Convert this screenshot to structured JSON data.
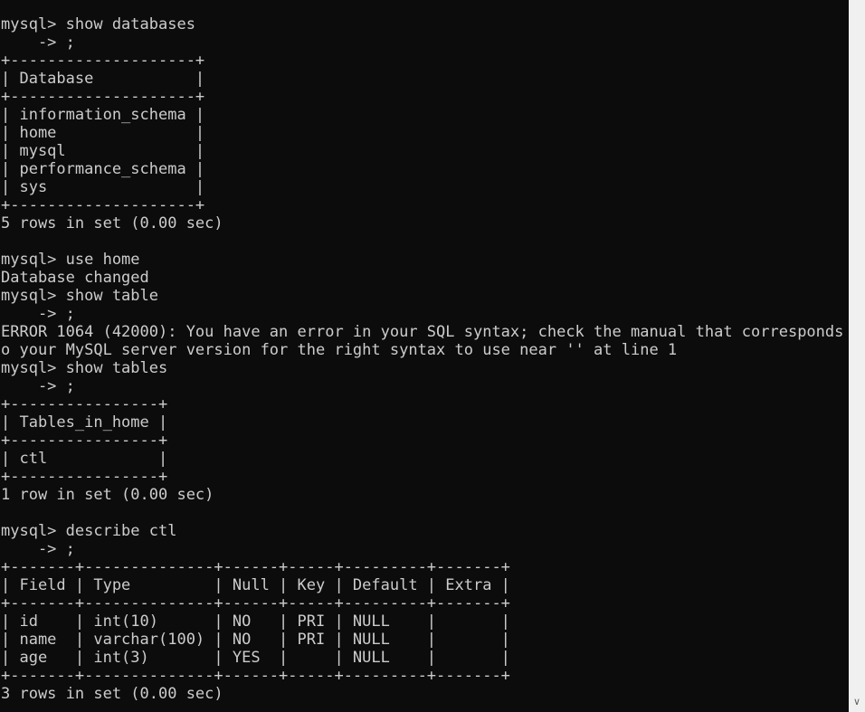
{
  "terminal": {
    "lines": [
      "mysql> show databases",
      "    -> ;",
      "+--------------------+",
      "| Database           |",
      "+--------------------+",
      "| information_schema |",
      "| home               |",
      "| mysql              |",
      "| performance_schema |",
      "| sys                |",
      "+--------------------+",
      "5 rows in set (0.00 sec)",
      "",
      "mysql> use home",
      "Database changed",
      "mysql> show table",
      "    -> ;",
      "ERROR 1064 (42000): You have an error in your SQL syntax; check the manual that corresponds t",
      "o your MySQL server version for the right syntax to use near '' at line 1",
      "mysql> show tables",
      "    -> ;",
      "+----------------+",
      "| Tables_in_home |",
      "+----------------+",
      "| ctl            |",
      "+----------------+",
      "1 row in set (0.00 sec)",
      "",
      "mysql> describe ctl",
      "    -> ;",
      "+-------+--------------+------+-----+---------+-------+",
      "| Field | Type         | Null | Key | Default | Extra |",
      "+-------+--------------+------+-----+---------+-------+",
      "| id    | int(10)      | NO   | PRI | NULL    |       |",
      "| name  | varchar(100) | NO   | PRI | NULL    |       |",
      "| age   | int(3)       | YES  |     | NULL    |       |",
      "+-------+--------------+------+-----+---------+-------+",
      "3 rows in set (0.00 sec)"
    ]
  },
  "scrollbar": {
    "down_arrow_icon": "chevron-down-icon"
  },
  "colors": {
    "background": "#0c0c0c",
    "text": "#cccccc",
    "scrollbar": "#f0f0f0"
  }
}
